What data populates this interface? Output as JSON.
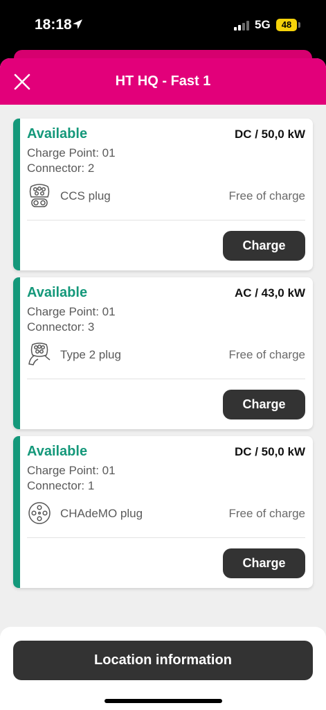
{
  "status_bar": {
    "time": "18:18",
    "network": "5G",
    "battery": "48"
  },
  "header": {
    "title": "HT HQ - Fast 1",
    "close_icon": "close-icon"
  },
  "connectors": [
    {
      "status": "Available",
      "power": "DC / 50,0 kW",
      "charge_point": "Charge Point: 01",
      "connector": "Connector: 2",
      "plug_icon": "ccs-plug-icon",
      "plug": "CCS plug",
      "price": "Free of charge",
      "button": "Charge"
    },
    {
      "status": "Available",
      "power": "AC / 43,0 kW",
      "charge_point": "Charge Point: 01",
      "connector": "Connector: 3",
      "plug_icon": "type2-plug-icon",
      "plug": "Type 2 plug",
      "price": "Free of charge",
      "button": "Charge"
    },
    {
      "status": "Available",
      "power": "DC / 50,0 kW",
      "charge_point": "Charge Point: 01",
      "connector": "Connector: 1",
      "plug_icon": "chademo-plug-icon",
      "plug": "CHAdeMO plug",
      "price": "Free of charge",
      "button": "Charge"
    }
  ],
  "footer": {
    "location_button": "Location information"
  },
  "colors": {
    "brand": "#e2007a",
    "available": "#14987a",
    "button": "#333333",
    "background": "#efefef"
  }
}
